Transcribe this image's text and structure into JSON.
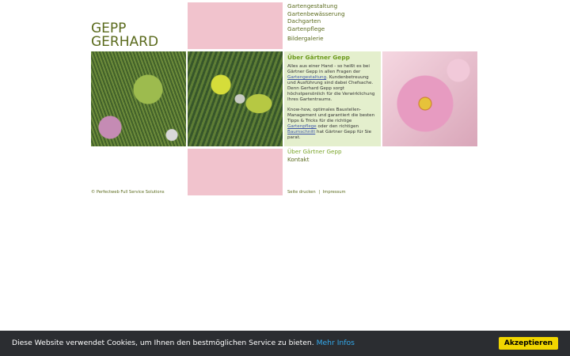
{
  "logo": {
    "line1": "GEPP",
    "line2": "GERHARD"
  },
  "nav": {
    "items": [
      {
        "label": "Gartengestaltung"
      },
      {
        "label": "Gartenbewässerung"
      },
      {
        "label": "Dachgarten"
      },
      {
        "label": "Gartenpflege"
      }
    ],
    "gallery": "Bildergalerie"
  },
  "about": {
    "title": "Über Gärtner Gepp",
    "p1_a": "Alles aus einer Hand - so heißt es bei Gärtner Gepp in allen Fragen der ",
    "p1_link": "Gartengestaltung",
    "p1_b": ". Kundenbetreuung und Ausführung sind dabei Chefsache. Denn Gerhard Gepp sorgt höchstpersönlich für die Verwirklichung Ihres Gartentraums.",
    "p2_a": "Know-how, optimales Baustellen-Management und garantiert die besten Tipps & Tricks für die richtige ",
    "p2_link1": "Gartenpflege",
    "p2_b": " oder den richtigen ",
    "p2_link2": "Baumschnitt",
    "p2_c": " hat Gärtner Gepp für Sie parat."
  },
  "nav2": {
    "items": [
      {
        "label": "Über Gärtner Gepp"
      },
      {
        "label": "Kontakt"
      }
    ]
  },
  "footer": {
    "copyright": "© Perfectweb Full Service Solutions",
    "print": "Seite drucken",
    "separator": "|",
    "imprint": "Impressum"
  },
  "cookie": {
    "message": "Diese Website verwendet Cookies, um Ihnen den bestmöglichen Service zu bieten.",
    "more": "Mehr Infos",
    "accept": "Akzeptieren"
  },
  "colors": {
    "brand": "#5a6a1c",
    "accent_green": "#6c9a1c",
    "pink": "#f1c3cd",
    "text_bg": "#e4efcd",
    "cookie_bar": "#2b2d31",
    "cookie_button": "#f1d600"
  }
}
